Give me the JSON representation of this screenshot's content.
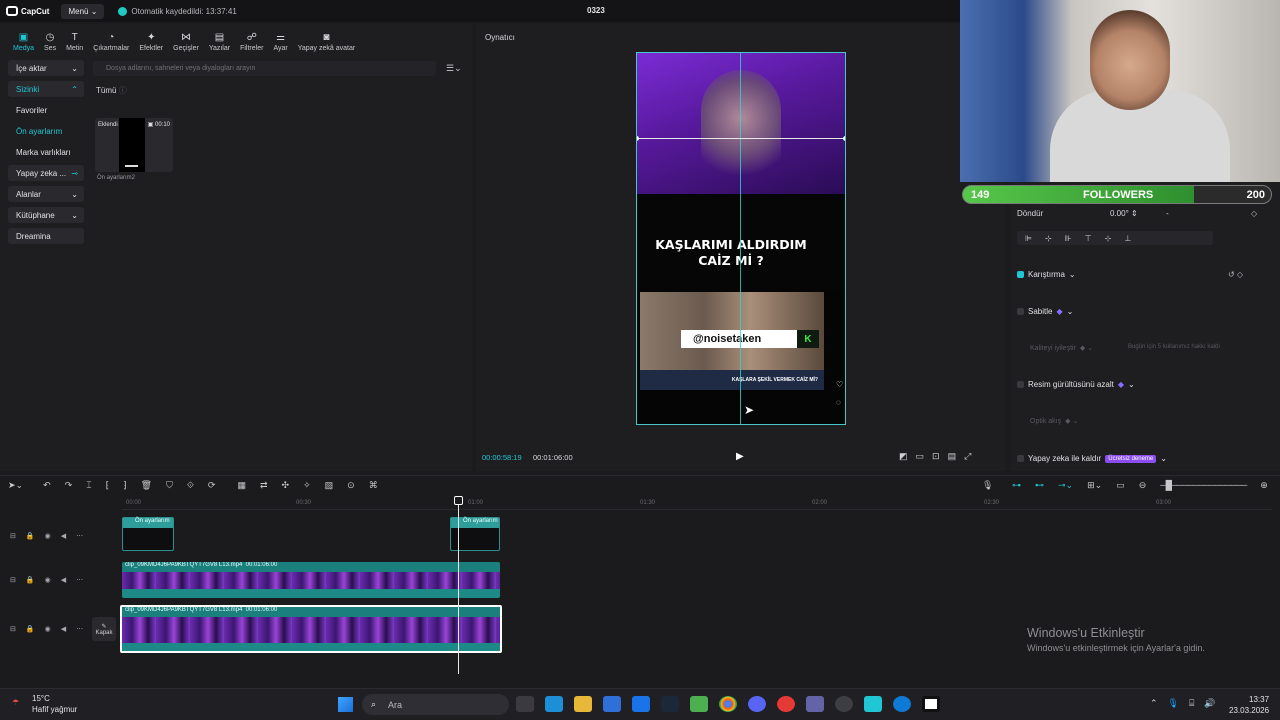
{
  "titlebar": {
    "app_name": "CapCut",
    "menu_label": "Menü",
    "autosave": "Otomatik kaydedildi: 13:37:41",
    "project": "0323"
  },
  "toolbar": {
    "items": [
      "Medya",
      "Ses",
      "Metin",
      "Çıkartmalar",
      "Efektler",
      "Geçişler",
      "Yazılar",
      "Filtreler",
      "Ayar",
      "Yapay zekâ avatar"
    ]
  },
  "sidebar": {
    "items": [
      "İçe aktar",
      "Sizinki",
      "Favoriler",
      "Ön ayarlarım",
      "Marka varlıkları",
      "Yapay zeka ...",
      "Alanlar",
      "Kütüphane",
      "Dreamina"
    ]
  },
  "media": {
    "search_placeholder": "Dosya adlarını, sahneleri veya diyalogları arayın",
    "filter_all": "Tümü",
    "thumb_label": "Eklendi",
    "thumb_duration": "00:10",
    "thumb_caption": "Ön ayarlarım2"
  },
  "player": {
    "title": "Oynatıcı",
    "headline_line1": "KAŞLARIMI ALDIRDIM",
    "headline_line2": "CAİZ Mİ ?",
    "handle": "@noisetaken",
    "handle_badge": "K",
    "lower_third": "KAŞLARA ŞEKİL VERMEK CAİZ Mİ?",
    "time_current": "00:00:58:19",
    "time_total": "00:01:06:00"
  },
  "stream_overlay": {
    "followers_current": "149",
    "followers_label": "FOLLOWERS",
    "followers_goal": "200",
    "progress": 0.75
  },
  "inspector": {
    "rotate_label": "Döndür",
    "rotate_value": "0.00°",
    "rotate_dash": "-",
    "blend_label": "Karıştırma",
    "stabilize_label": "Sabitle",
    "frame_enhance_label": "Kaliteyi iyileştir",
    "frame_enhance_note": "Bugün için 5 kullanımız hakkı kaldı",
    "denoise_label": "Resim gürültüsünü azalt",
    "optical_label": "Optik akış",
    "ai_remove_label": "Yapay zeka ile kaldır",
    "ai_remove_badge": "Ücretsiz deneme"
  },
  "timeline": {
    "ticks": [
      "00:00",
      "00:30",
      "01:00",
      "01:30",
      "02:00",
      "02:30",
      "03:00"
    ],
    "overlay_clip_label": "Ön ayarlarım",
    "video_clip_name": "clip_09KMD4J6PA9KBTQYT7GV8 L13.mp4",
    "video_clip_duration": "00:01:06:00",
    "cover_label": "Kapak"
  },
  "windows_activation": {
    "title": "Windows'u Etkinleştir",
    "subtitle": "Windows'u etkinleştirmek için Ayarlar'a gidin."
  },
  "taskbar": {
    "temperature": "15°C",
    "weather": "Hafif yağmur",
    "search_placeholder": "Ara",
    "time": "13:37",
    "date": "23.03.2026"
  },
  "colors": {
    "accent": "#1fc7d4",
    "followers_green": "#57c74a",
    "video_purple": "#7b2cd6"
  }
}
